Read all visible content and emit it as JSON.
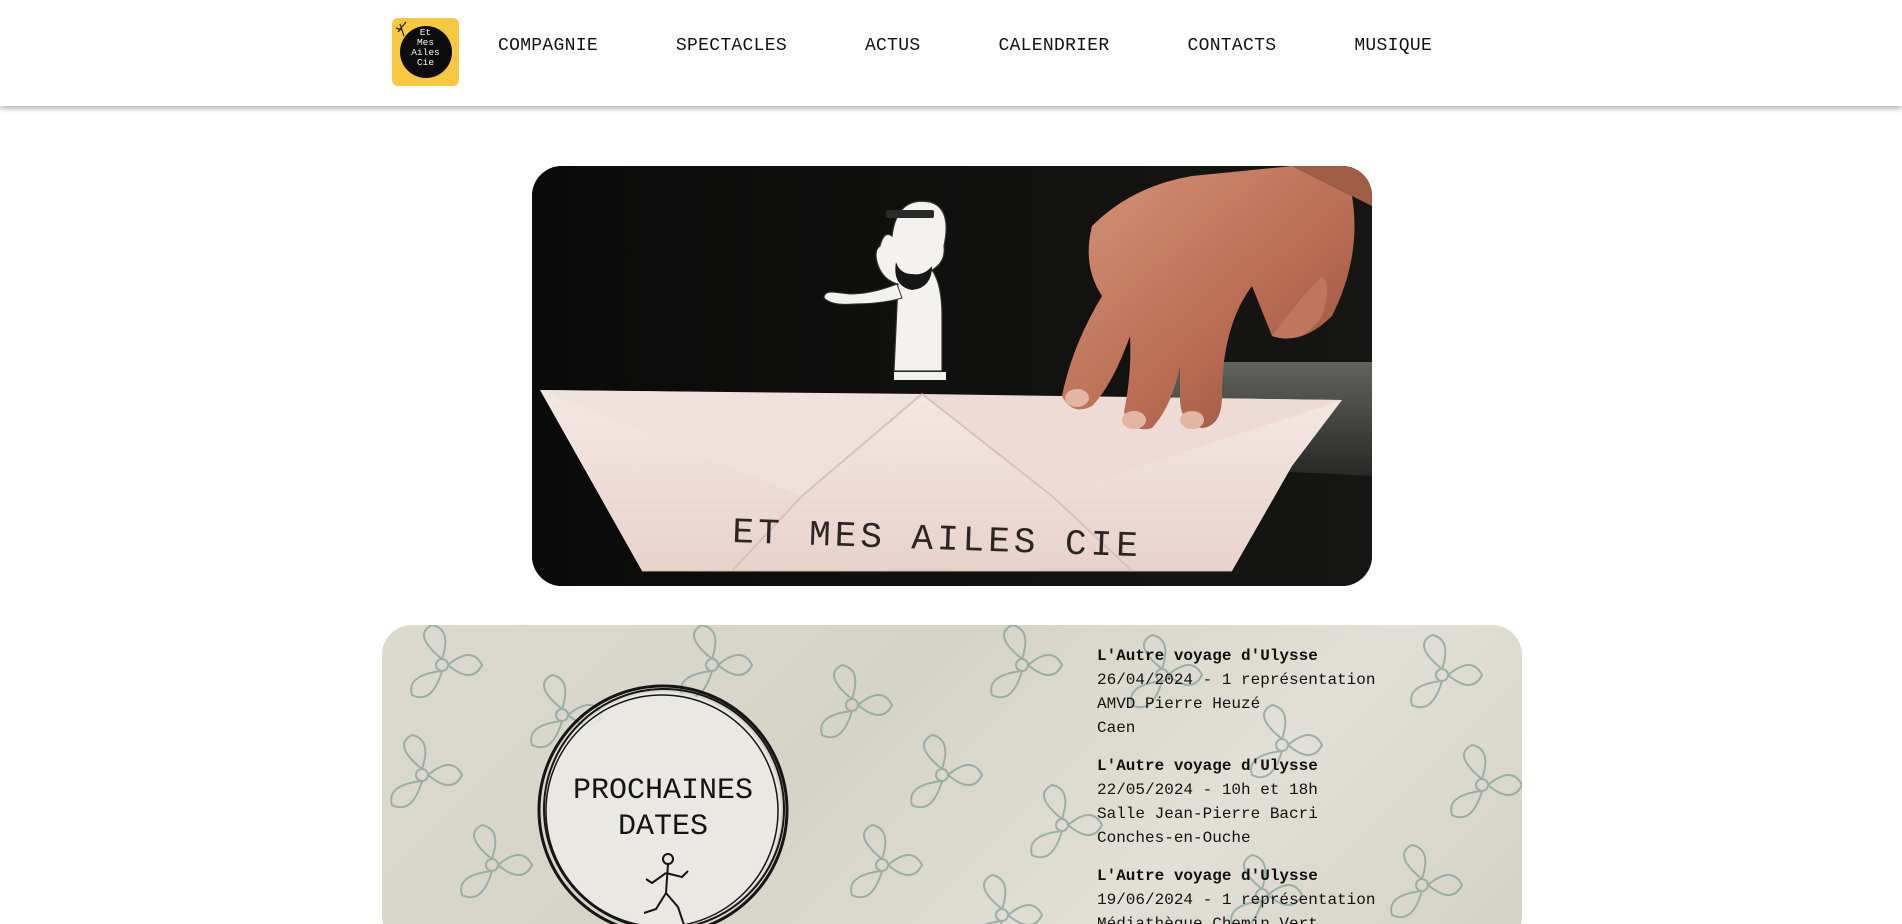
{
  "header": {
    "logo_text": "Et\nMes\nAiles\nCie",
    "nav": [
      {
        "label": "COMPAGNIE"
      },
      {
        "label": "SPECTACLES"
      },
      {
        "label": "ACTUS"
      },
      {
        "label": "CALENDRIER"
      },
      {
        "label": "CONTACTS"
      },
      {
        "label": "MUSIQUE"
      }
    ]
  },
  "hero": {
    "boat_text": "ET MES AILES CIE"
  },
  "dates": {
    "badge_title": "PROCHAINES\nDATES",
    "events": [
      {
        "title": "L'Autre voyage d'Ulysse",
        "date": "26/04/2024 - 1 représentation",
        "venue": "AMVD Pierre Heuzé",
        "city": "Caen"
      },
      {
        "title": "L'Autre voyage d'Ulysse",
        "date": "22/05/2024 - 10h et 18h",
        "venue": "Salle Jean-Pierre Bacri",
        "city": "Conches-en-Ouche"
      },
      {
        "title": "L'Autre voyage d'Ulysse",
        "date": "19/06/2024 - 1 représentation",
        "venue": "Médiathèque Chemin Vert",
        "city": ""
      }
    ]
  },
  "colors": {
    "logo_bg": "#f8c843",
    "hero_bg": "#0d0d0c",
    "panel_bg": "#dcdacf",
    "pattern": "#7f9c97"
  }
}
